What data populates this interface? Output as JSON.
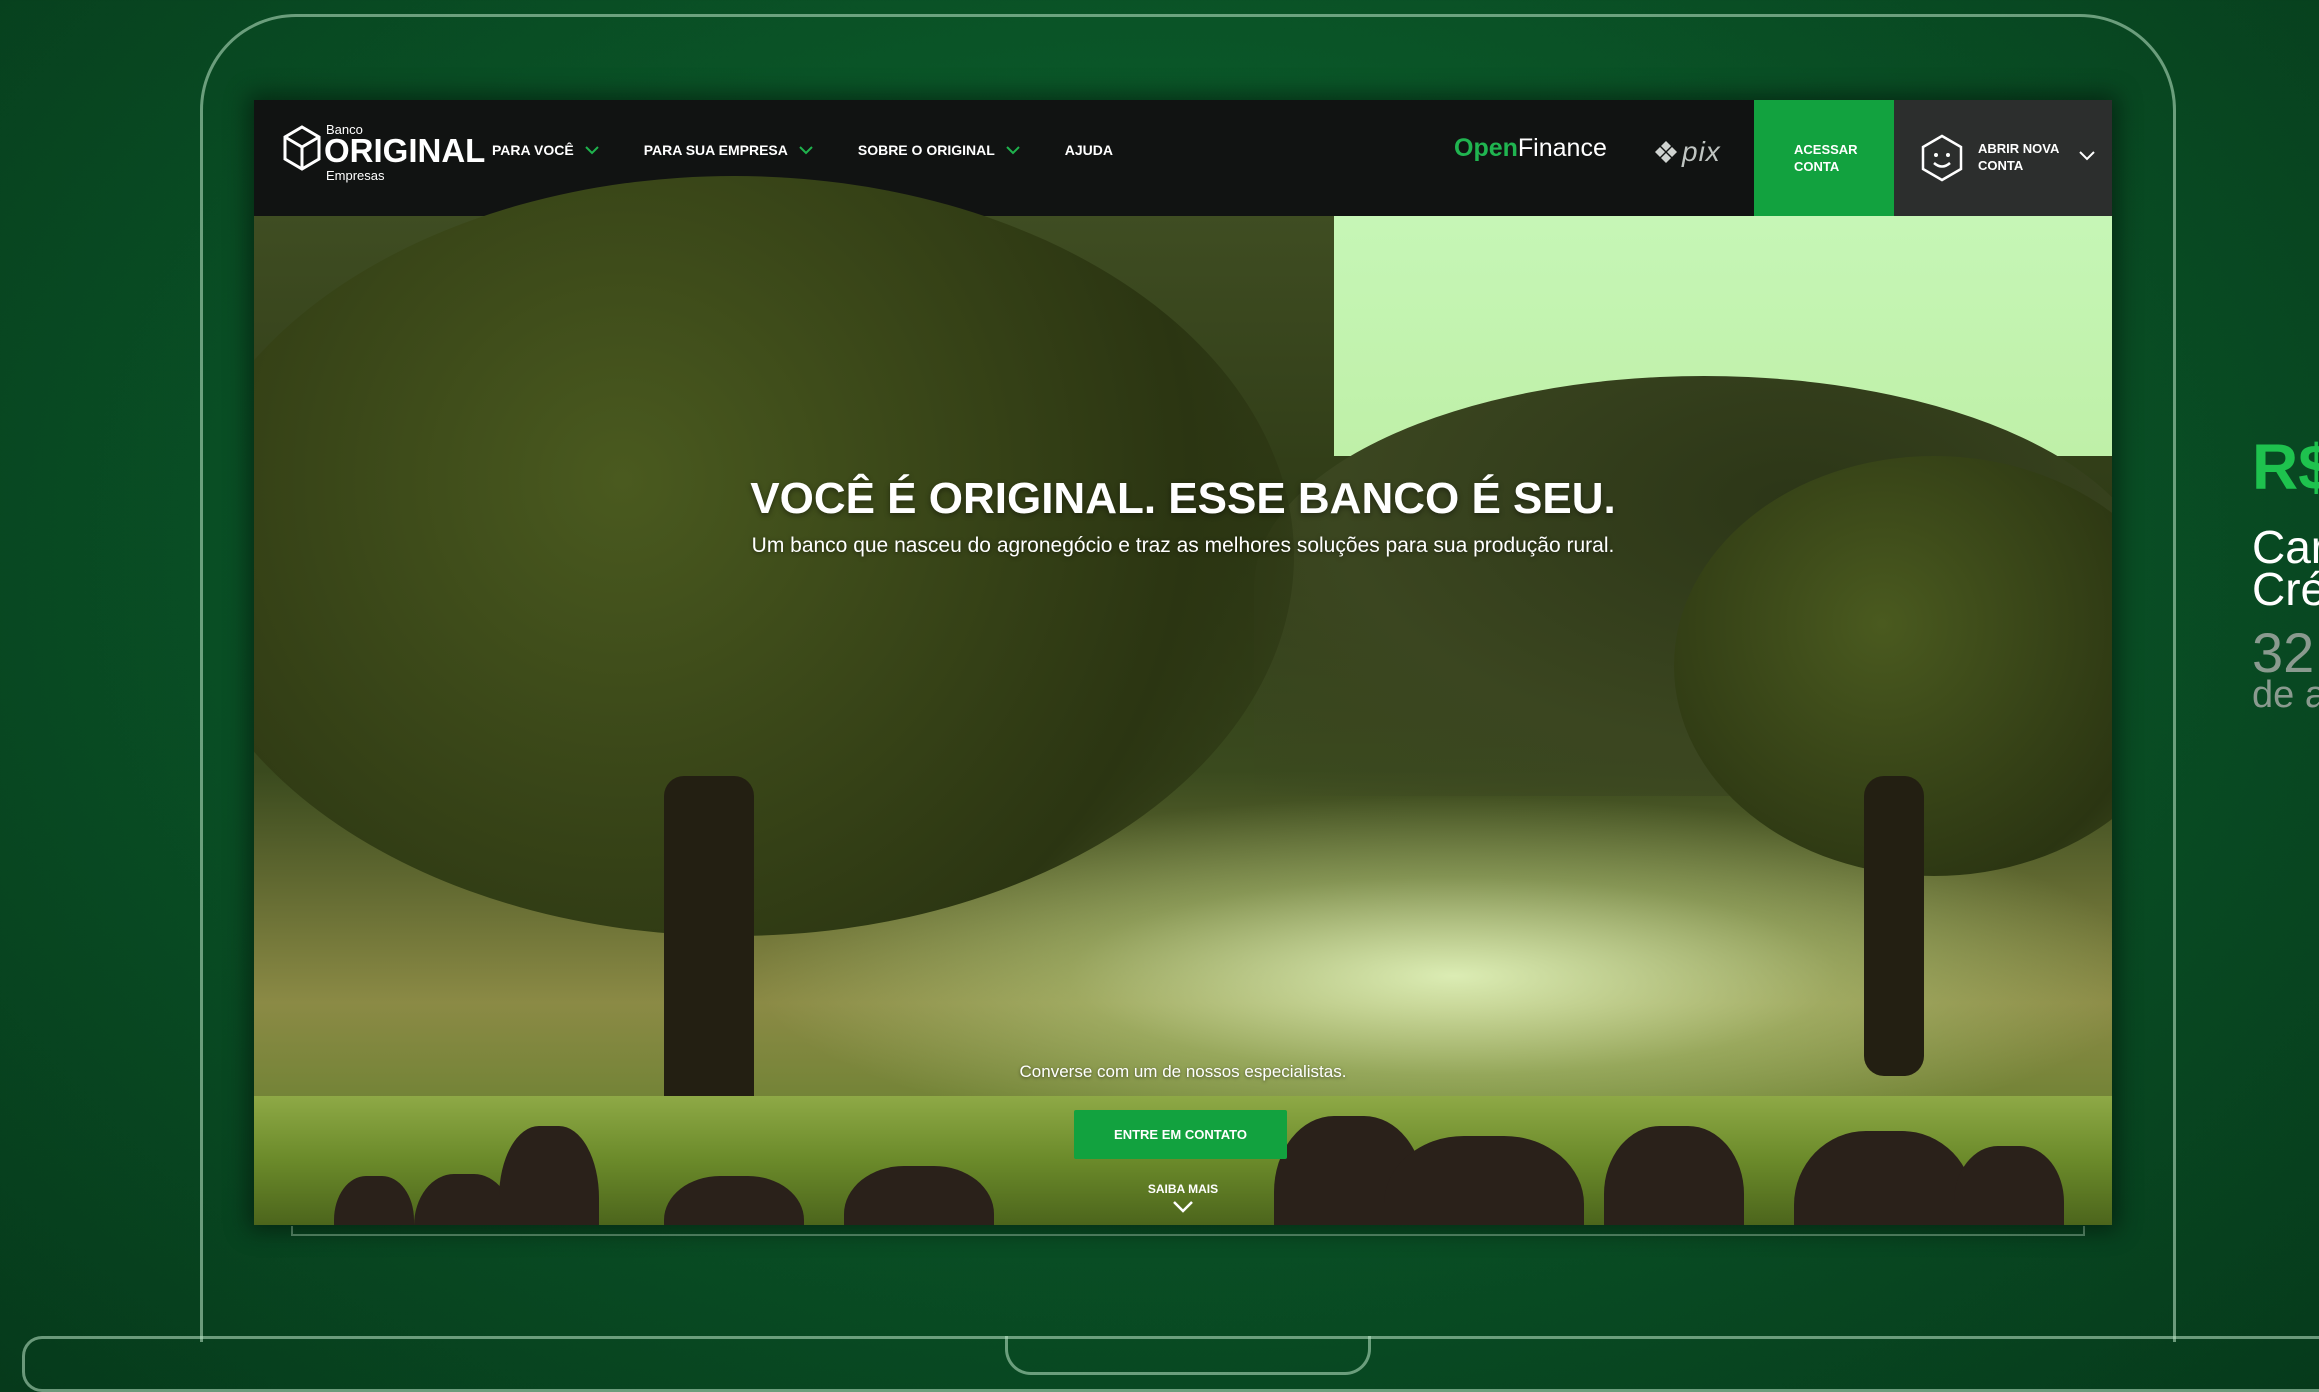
{
  "nav": {
    "logo": {
      "banco": "Banco",
      "original": "ORIGINAL",
      "empresas": "Empresas"
    },
    "menu": [
      {
        "label": "PARA VOCÊ",
        "has_dropdown": true
      },
      {
        "label": "PARA SUA EMPRESA",
        "has_dropdown": true
      },
      {
        "label": "SOBRE O ORIGINAL",
        "has_dropdown": true
      },
      {
        "label": "AJUDA",
        "has_dropdown": false
      }
    ],
    "openfinance": {
      "open": "Open",
      "finance": "Finance"
    },
    "pix": "pix",
    "acessar_conta": "ACESSAR CONTA",
    "abrir_nova_conta": "ABRIR NOVA CONTA"
  },
  "hero": {
    "title": "VOCÊ É ORIGINAL. ESSE BANCO É SEU.",
    "subtitle": "Um banco que nasceu do agronegócio e traz as melhores soluções para sua produção rural.",
    "cta_text": "Converse com um de nossos especialistas.",
    "cta_button": "ENTRE EM CONTATO",
    "saiba_mais": "SAIBA MAIS"
  },
  "side_peek": {
    "currency": "R$",
    "line1": "Car",
    "line2": "Cré",
    "number": "32",
    "sub": "de a"
  },
  "colors": {
    "brand_green": "#12a23f",
    "openfinance_green": "#20b450",
    "nav_bg": "#111312",
    "background_green": "#0a5427"
  }
}
